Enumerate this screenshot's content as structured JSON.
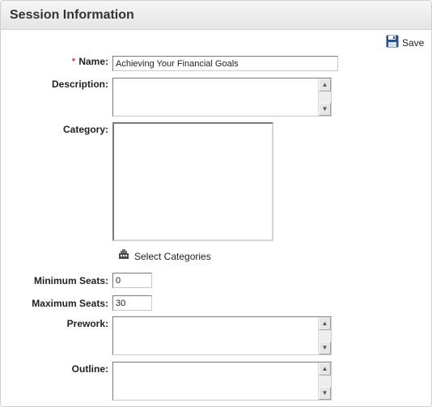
{
  "panel": {
    "title": "Session Information"
  },
  "toolbar": {
    "save_label": "Save",
    "save_icon": "floppy-disk-icon"
  },
  "form": {
    "name": {
      "required_marker": "*",
      "label": "Name:",
      "value": "Achieving Your Financial Goals"
    },
    "description": {
      "label": "Description:",
      "value": ""
    },
    "category": {
      "label": "Category:",
      "select_label": "Select Categories",
      "select_icon": "category-picker-icon"
    },
    "minimum_seats": {
      "label": "Minimum Seats:",
      "value": "0"
    },
    "maximum_seats": {
      "label": "Maximum Seats:",
      "value": "30"
    },
    "prework": {
      "label": "Prework:",
      "value": ""
    },
    "outline": {
      "label": "Outline:",
      "value": ""
    }
  },
  "colors": {
    "header_bg": "#e9e9e9",
    "required": "#cc0000",
    "save_icon": "#2a4f8f"
  }
}
